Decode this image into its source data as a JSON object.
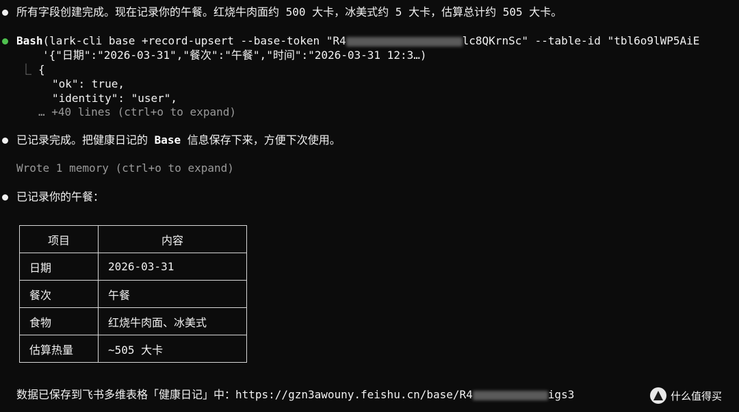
{
  "messages": {
    "m1": "所有字段创建完成。现在记录你的午餐。红烧牛肉面约 500 大卡，冰美式约 5 大卡，估算总计约 505 大卡。",
    "tool_name": "Bash",
    "tool_cmd_a": "(lark-cli base +record-upsert --base-token \"R4",
    "tool_cmd_b": "lc8QKrnSc\" --table-id \"tbl6o9lWP5AiE",
    "tool_cmd_line2": "'{\"日期\":\"2026-03-31\",\"餐次\":\"午餐\",\"时间\":\"2026-03-31 12:3…)",
    "out_brace": "{",
    "out_ok": "\"ok\": true,",
    "out_identity": "\"identity\": \"user\",",
    "out_more": "… +40 lines (ctrl+o to expand)",
    "m2_a": "已记录完成。把健康日记的 ",
    "m2_base": "Base",
    "m2_b": " 信息保存下来，方便下次使用。",
    "memory": "Wrote 1 memory (ctrl+o to expand)",
    "m3": "已记录你的午餐：",
    "saved_a": "数据已保存到飞书多维表格「健康日记」中：https://gzn3awouny.feishu.cn/base/R4",
    "saved_b": "igs3"
  },
  "table": {
    "headers": [
      "项目",
      "内容"
    ],
    "rows": [
      [
        "日期",
        "2026-03-31"
      ],
      [
        "餐次",
        "午餐"
      ],
      [
        "食物",
        "红烧牛肉面、冰美式"
      ],
      [
        "估算热量",
        "~505 大卡"
      ]
    ]
  },
  "watermark": "什么值得买",
  "colors": {
    "background": "#0c0c0c",
    "text": "#e6e6e6",
    "success_bullet": "#4fc14f",
    "dim": "#9a9a9a"
  }
}
